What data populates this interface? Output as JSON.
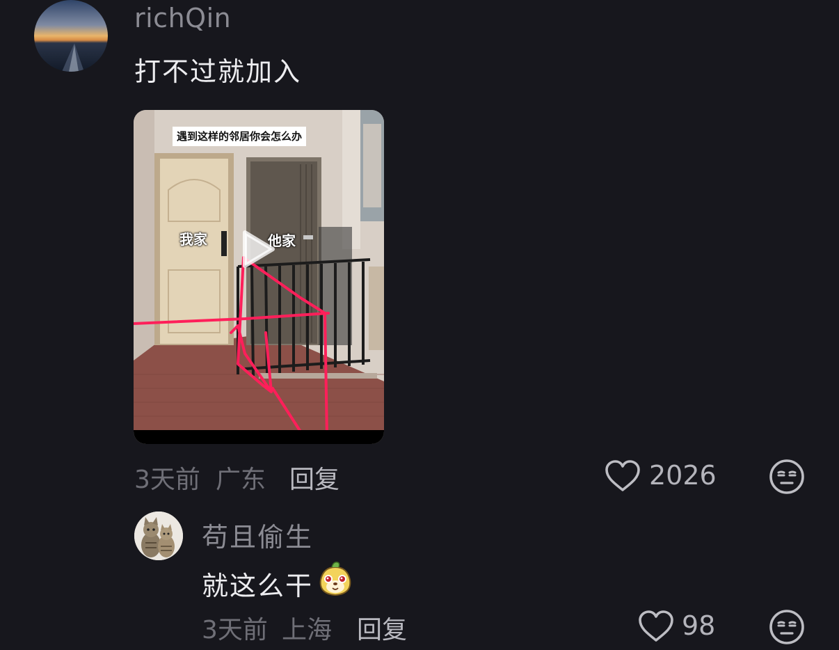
{
  "comments": [
    {
      "username": "richQin",
      "text": "打不过就加入",
      "media": {
        "caption": "遇到这样的邻居你会怎么办",
        "label_left": "我家",
        "label_right": "他家"
      },
      "time": "3天前",
      "location": "广东",
      "reply_label": "回复",
      "likes": "2026"
    },
    {
      "username": "苟且偷生",
      "text": "就这么干",
      "time": "3天前",
      "location": "上海",
      "reply_label": "回复",
      "likes": "98"
    }
  ],
  "icons": {
    "like": "heart-outline-icon",
    "dislike": "meh-face-icon",
    "play": "play-icon",
    "sticker": "cute-face-sticker"
  },
  "colors": {
    "background": "#17171d",
    "text_primary": "#ededf0",
    "text_secondary": "#8c8c94",
    "annotation": "#ff1f5a"
  }
}
